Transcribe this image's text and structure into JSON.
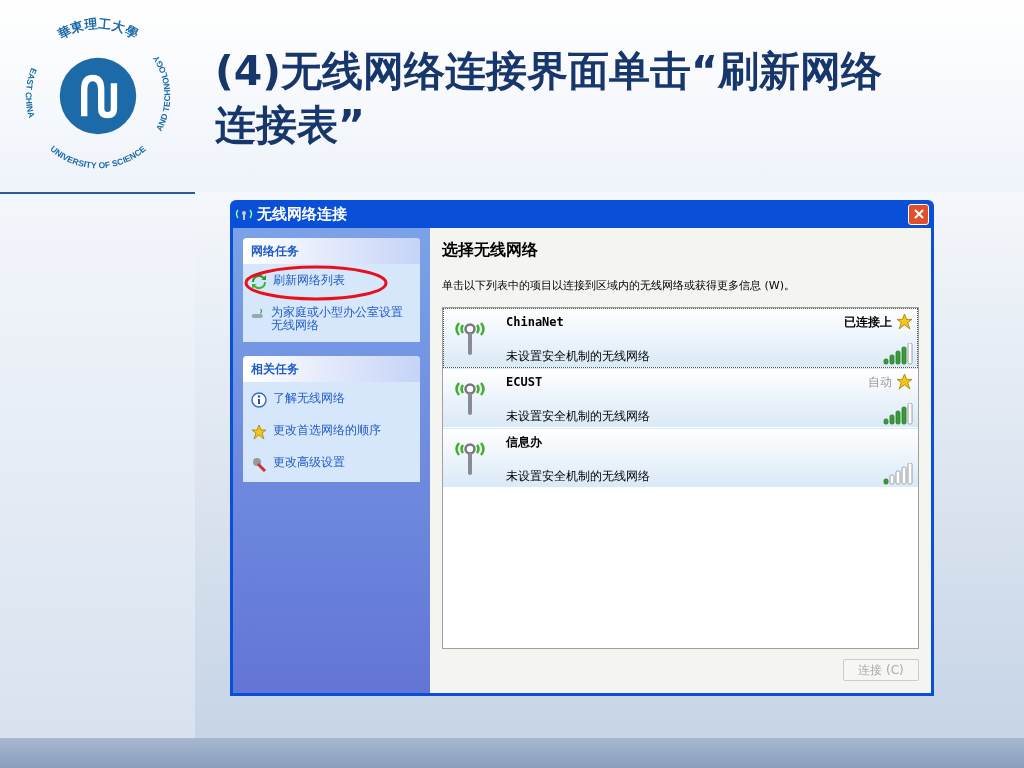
{
  "logo": {
    "chinese": "華東理工大學",
    "english": [
      "EAST CHINA",
      "UNIVERSITY OF SCIENCE",
      "AND TECHNOLOGY"
    ]
  },
  "title": "(4)无线网络连接界面单击“刷新网络连接表”",
  "window": {
    "title": "无线网络连接"
  },
  "sidebar": [
    {
      "heading": "网络任务",
      "items": [
        {
          "label": "刷新网络列表",
          "kind": "refresh",
          "highlighted": true
        },
        {
          "label": "为家庭或小型办公室设置无线网络",
          "kind": "setup",
          "highlighted": false
        }
      ]
    },
    {
      "heading": "相关任务",
      "items": [
        {
          "label": "了解无线网络",
          "kind": "info",
          "highlighted": false
        },
        {
          "label": "更改首选网络的顺序",
          "kind": "star",
          "highlighted": false
        },
        {
          "label": "更改高级设置",
          "kind": "tools",
          "highlighted": false
        }
      ]
    }
  ],
  "main": {
    "heading": "选择无线网络",
    "instruction": "单击以下列表中的项目以连接到区域内的无线网络或获得更多信息 (W)。",
    "networks": [
      {
        "name": "ChinaNet",
        "status": "已连接上",
        "connected": true,
        "preferred": true,
        "security": "未设置安全机制的无线网络",
        "level": 0.8,
        "selected": true
      },
      {
        "name": "ECUST",
        "status": "自动",
        "connected": false,
        "preferred": true,
        "security": "未设置安全机制的无线网络",
        "level": 0.8,
        "selected": false
      },
      {
        "name": "信息办",
        "preferred": false,
        "security": "未设置安全机制的无线网络",
        "level": 0.2,
        "selected": false
      }
    ],
    "connect_button": {
      "label": "连接 (C)",
      "disabled": true
    }
  }
}
